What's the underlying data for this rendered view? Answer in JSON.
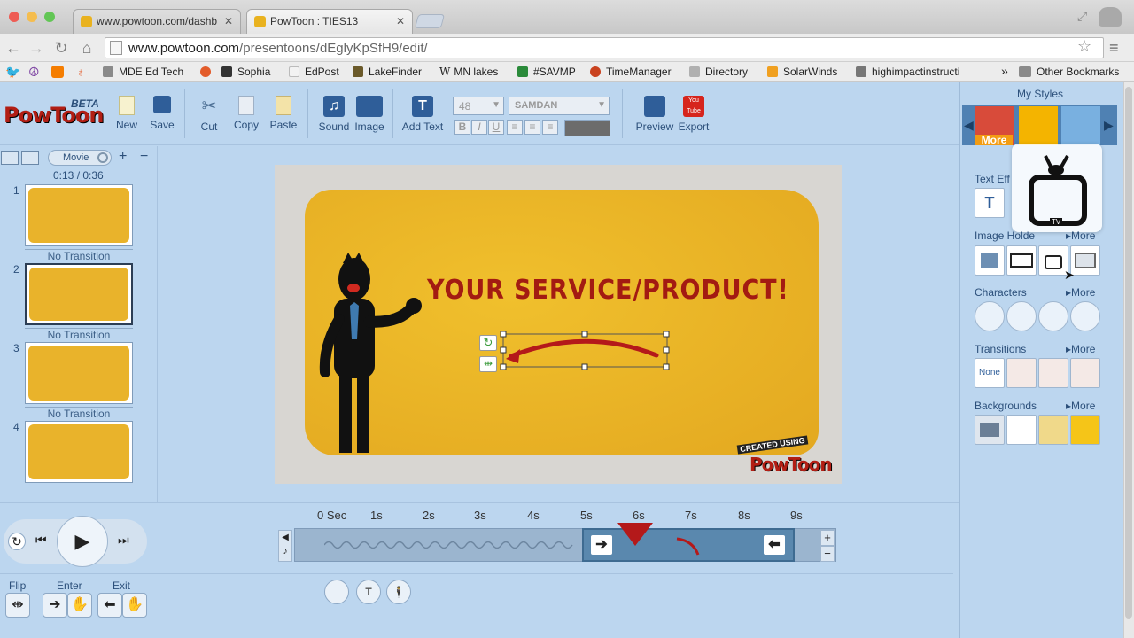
{
  "browser": {
    "tabs": [
      {
        "label": "www.powtoon.com/dashb"
      },
      {
        "label": "PowToon : TIES13"
      }
    ],
    "url_host": "www.powtoon.com",
    "url_path": "/presentoons/dEglyKpSfH9/edit/",
    "bookmarks": [
      {
        "label": "MDE Ed Tech"
      },
      {
        "label": "Sophia"
      },
      {
        "label": "EdPost"
      },
      {
        "label": "LakeFinder"
      },
      {
        "label": "MN lakes"
      },
      {
        "label": "#SAVMP"
      },
      {
        "label": "TimeManager"
      },
      {
        "label": "Directory"
      },
      {
        "label": "SolarWinds"
      },
      {
        "label": "highimpactinstructi"
      }
    ],
    "other_bookmarks": "Other Bookmarks",
    "overflow": "»"
  },
  "logo": {
    "text": "PowToon",
    "beta": "BETA"
  },
  "toolbar": {
    "new": "New",
    "save": "Save",
    "cut": "Cut",
    "copy": "Copy",
    "paste": "Paste",
    "sound": "Sound",
    "image": "Image",
    "add_text": "Add Text",
    "font_size": "48",
    "font_name": "SAMDAN",
    "bold": "B",
    "italic": "I",
    "underline": "U",
    "preview": "Preview",
    "export": "Export",
    "youtube_text": "You Tube"
  },
  "left": {
    "movie_label": "Movie",
    "time": "0:13 / 0:36",
    "plus": "+",
    "minus": "−",
    "slides": [
      {
        "num": "1"
      },
      {
        "num": "2"
      },
      {
        "num": "3"
      },
      {
        "num": "4"
      }
    ],
    "transitions": [
      "No Transition",
      "No Transition",
      "No Transition"
    ]
  },
  "stage": {
    "headline": "YOUR SERVICE/PRODUCT!",
    "created_using": "CREATED USING",
    "watermark": "PowToon"
  },
  "right": {
    "my_styles": "My Styles",
    "more_badge": "More",
    "text_effects": "Text Eff",
    "image_holders": "Image Holde",
    "characters": "Characters",
    "transitions": "Transitions",
    "backgrounds": "Backgrounds",
    "more": "More",
    "transition_none": "None",
    "tv_label": "TV"
  },
  "timeline": {
    "ticks": [
      "0 Sec",
      "1s",
      "2s",
      "3s",
      "4s",
      "5s",
      "6s",
      "7s",
      "8s",
      "9s"
    ],
    "flip": "Flip",
    "enter": "Enter",
    "exit": "Exit"
  },
  "colors": {
    "stage_yellow": "#e9b32b",
    "headline_red": "#a31b12",
    "panel_blue": "#bcd6ef",
    "bg_white": "#ffffff",
    "bg_pale": "#f0d98a",
    "bg_yellow": "#f5c518"
  }
}
